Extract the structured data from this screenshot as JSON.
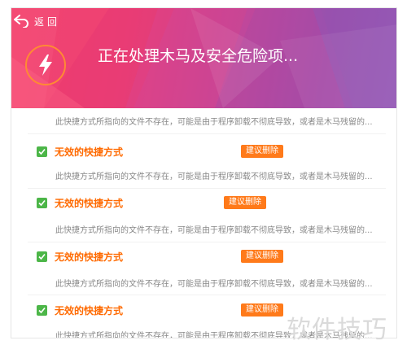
{
  "header": {
    "back_label": "返回",
    "title": "正在处理木马及安全危险项..."
  },
  "rows": [
    {
      "title": "",
      "desc": "此快捷方式所指向的文件不存在，可能是由于程序卸载不彻底导致，或者是木马残留的...",
      "action": ""
    },
    {
      "title": "无效的快捷方式",
      "desc": "此快捷方式所指向的文件不存在，可能是由于程序卸载不彻底导致，或者是木马残留的...",
      "action": "建议删除",
      "checked": true
    },
    {
      "title": "无效的快捷方式",
      "desc": "此快捷方式所指向的文件不存在，可能是由于程序卸载不彻底导致，或者是木马残留的...",
      "action": "建议删除",
      "checked": true
    },
    {
      "title": "无效的快捷方式",
      "desc": "此快捷方式所指向的文件不存在，可能是由于程序卸载不彻底导致，或者是木马残留的...",
      "action": "建议删除",
      "checked": true
    },
    {
      "title": "无效的快捷方式",
      "desc": "此快捷方式所指向的文件不存在，可能是由于程序卸载不彻底导致，或者是木马残留的...",
      "action": "建议删除",
      "checked": true
    }
  ],
  "watermark": "软件技巧",
  "icons": {
    "back": "back-arrow-icon",
    "bolt": "lightning-bolt-icon",
    "check": "checkmark-icon"
  },
  "colors": {
    "header_start": "#f2406d",
    "header_end": "#9a59b4",
    "accent_orange": "#ff7a1a",
    "check_green": "#4cb648"
  }
}
